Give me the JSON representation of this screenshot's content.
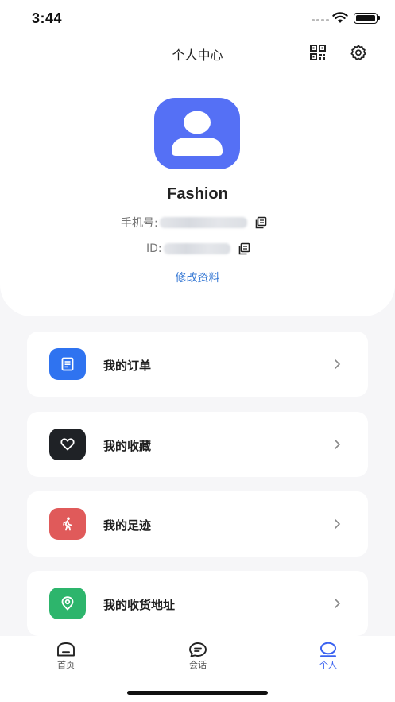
{
  "status_bar": {
    "time": "3:44"
  },
  "header": {
    "title": "个人中心",
    "qr_icon": "qr-code-icon",
    "settings_icon": "gear-icon"
  },
  "profile": {
    "avatar_icon": "user-icon",
    "name": "Fashion",
    "phone_label": "手机号:",
    "id_label": "ID:",
    "edit_link": "修改资料"
  },
  "menu": [
    {
      "label": "我的订单",
      "icon": "order-document-icon",
      "color": "#2f73f0"
    },
    {
      "label": "我的收藏",
      "icon": "heart-icon",
      "color": "#1f2226"
    },
    {
      "label": "我的足迹",
      "icon": "walking-person-icon",
      "color": "#e05a5a"
    },
    {
      "label": "我的收货地址",
      "icon": "location-pin-icon",
      "color": "#2db56c"
    }
  ],
  "tab_bar": {
    "tabs": [
      {
        "label": "首页",
        "icon": "home-icon"
      },
      {
        "label": "会话",
        "icon": "chat-bubble-icon"
      },
      {
        "label": "个人",
        "icon": "profile-icon"
      }
    ],
    "active_index": 2,
    "accent": "#3a62f0"
  }
}
